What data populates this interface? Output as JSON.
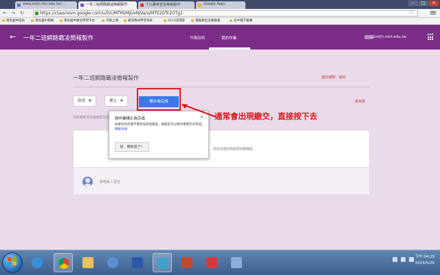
{
  "browser": {
    "tabs": [
      {
        "label": "www.mtjh.ntct.edu.tw/...",
        "active": false,
        "icon": "site-favicon"
      },
      {
        "label": "一年二班網路霸凌簡報製作",
        "active": true,
        "icon": "classroom-favicon"
      },
      {
        "label": "十九聯考宣言簡易操作",
        "active": false,
        "icon": "youtube-favicon"
      },
      {
        "label": "Google Apps",
        "active": false,
        "icon": "google-favicon"
      }
    ],
    "url": "https://classroom.google.com/u/0/c/MTMzMjUxNjVa/a/MTE2OTc2OTg1",
    "bookmarks": [
      "南投國中區站",
      "南投國中教職",
      "南投國中數位學習平台",
      "作業上傳",
      "補充教材學習系統",
      "2013認證家",
      "電腦教室設備維護",
      "名中電子書櫃"
    ]
  },
  "appbar": {
    "back_icon": "back-arrow-icon",
    "course_title": "一年二班網路霸凌簡報製作",
    "nav_tabs": [
      "作業說明",
      "我的作業"
    ],
    "active_tab": "我的作業",
    "user_email": "@mtjh.ntct.edu.tw",
    "apps_icon": "apps-grid-icon",
    "color": "#7b2d88"
  },
  "assignment": {
    "title": "一年二班網路霸凌簡報製作",
    "due": "繳交期限：明天",
    "add_label": "新增",
    "create_label": "建立",
    "mark_done_label": "標示為完成",
    "status": "未完成",
    "teacher_note": "切的老師可以檢視您在這段時間內",
    "card_text": "您尚未提出完成的作業檔案。",
    "comment_placeholder": "新增私人留言"
  },
  "popup": {
    "title": "將作業標示為完成",
    "close_icon": "close-icon",
    "body": "如果您的作業不需附加其他檔案，那麼您可以將作業標示為完成。",
    "link": "瞭解詳情",
    "ok_label": "好，我知道了！"
  },
  "annotation": {
    "text": "通常會出現繳交，直接按下去",
    "color": "#e0161b"
  },
  "taskbar": {
    "icons": [
      "start-orb-icon",
      "ie-icon",
      "chrome-icon",
      "explorer-icon",
      "media-icon",
      "word-icon",
      "browser-window-icon",
      "powerpoint-icon",
      "xmind-icon",
      "paint-icon"
    ],
    "time": "下午 04:25",
    "date": "2015/5/26"
  }
}
